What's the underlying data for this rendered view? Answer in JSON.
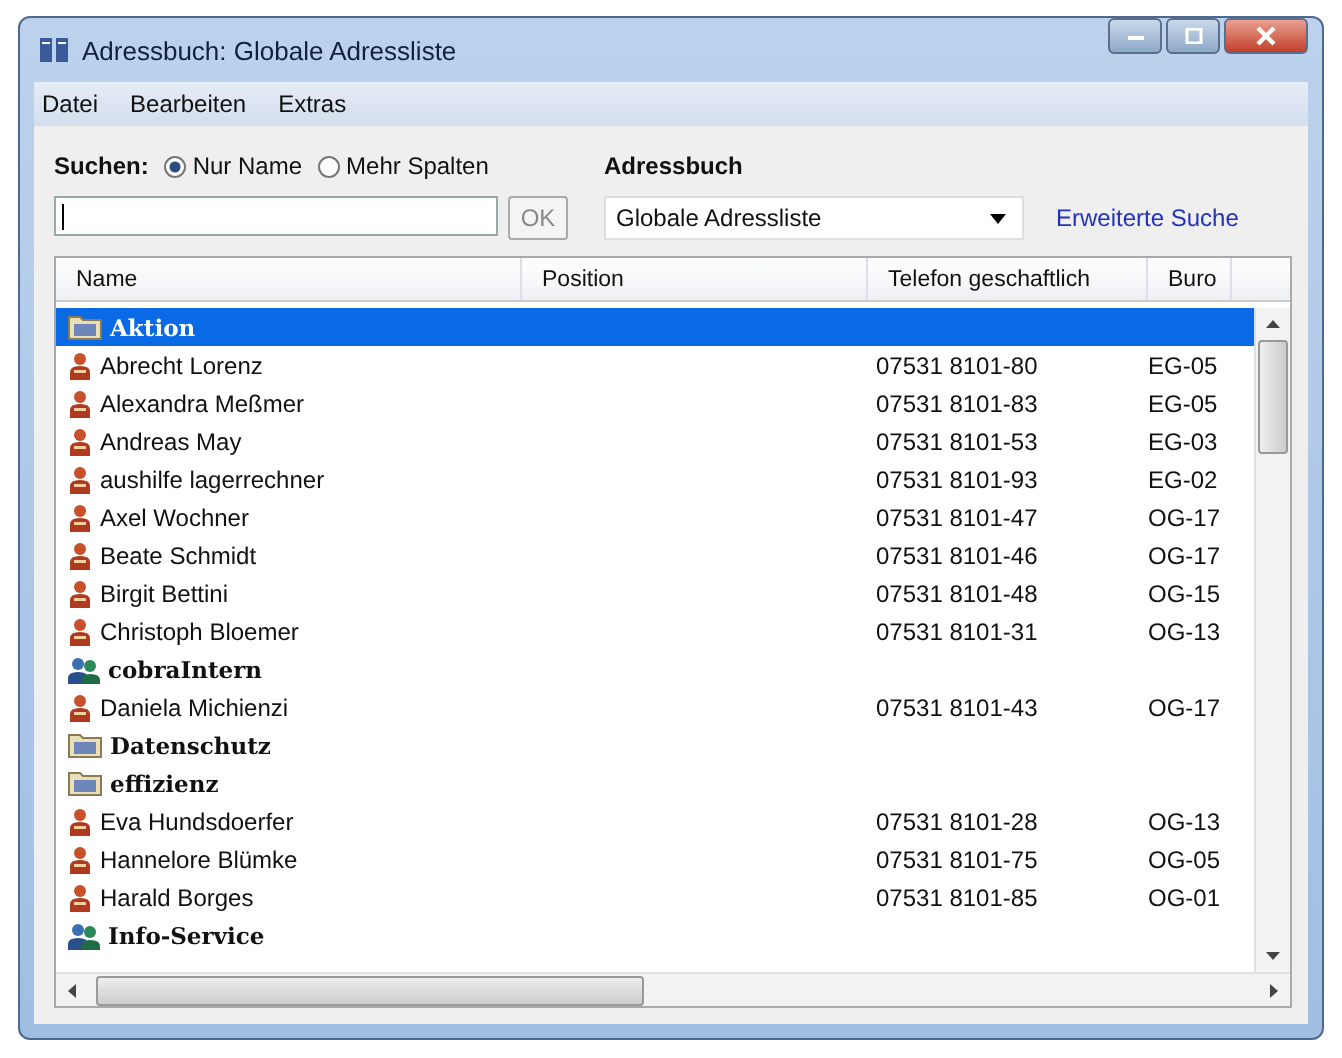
{
  "window": {
    "title": "Adressbuch: Globale Adressliste"
  },
  "menu": [
    "Datei",
    "Bearbeiten",
    "Extras"
  ],
  "search": {
    "label": "Suchen:",
    "options": [
      {
        "label": "Nur Name",
        "selected": true
      },
      {
        "label": "Mehr Spalten",
        "selected": false
      }
    ],
    "ok_button": {
      "label": "OK",
      "disabled": true
    }
  },
  "address_book": {
    "label": "Adressbuch",
    "value": "Globale Adressliste"
  },
  "advanced_search_link": "Erweiterte Suche",
  "table": {
    "columns": [
      "Name",
      "Position",
      "Telefon geschaftlich",
      "Buro"
    ],
    "rows": [
      {
        "kind": "folder",
        "name": "Aktion",
        "selected": true
      },
      {
        "kind": "person",
        "name": "Abrecht Lorenz",
        "phone": "07531 8101-80",
        "office": "EG-05",
        "selected": false
      },
      {
        "kind": "person",
        "name": "Alexandra Meßmer",
        "phone": "07531 8101-83",
        "office": "EG-05",
        "selected": false
      },
      {
        "kind": "person",
        "name": "Andreas May",
        "phone": "07531 8101-53",
        "office": "EG-03",
        "selected": false
      },
      {
        "kind": "person",
        "name": "aushilfe lagerrechner",
        "phone": "07531 8101-93",
        "office": "EG-02",
        "selected": false
      },
      {
        "kind": "person",
        "name": "Axel Wochner",
        "phone": "07531 8101-47",
        "office": "OG-17",
        "selected": false
      },
      {
        "kind": "person",
        "name": "Beate Schmidt",
        "phone": "07531 8101-46",
        "office": "OG-17",
        "selected": false
      },
      {
        "kind": "person",
        "name": "Birgit Bettini",
        "phone": "07531 8101-48",
        "office": "OG-15",
        "selected": false
      },
      {
        "kind": "person",
        "name": "Christoph Bloemer",
        "phone": "07531 8101-31",
        "office": "OG-13",
        "selected": false
      },
      {
        "kind": "group",
        "name": "cobraIntern",
        "selected": false
      },
      {
        "kind": "person",
        "name": "Daniela Michienzi",
        "phone": "07531 8101-43",
        "office": "OG-17",
        "selected": false
      },
      {
        "kind": "folder",
        "name": "Datenschutz",
        "selected": false
      },
      {
        "kind": "folder",
        "name": "effizienz",
        "selected": false
      },
      {
        "kind": "person",
        "name": "Eva Hundsdoerfer",
        "phone": "07531 8101-28",
        "office": "OG-13",
        "selected": false
      },
      {
        "kind": "person",
        "name": "Hannelore Blümke",
        "phone": "07531 8101-75",
        "office": "OG-05",
        "selected": false
      },
      {
        "kind": "person",
        "name": "Harald Borges",
        "phone": "07531 8101-85",
        "office": "OG-01",
        "selected": false
      },
      {
        "kind": "group",
        "name": "Info-Service",
        "selected": false
      }
    ]
  }
}
